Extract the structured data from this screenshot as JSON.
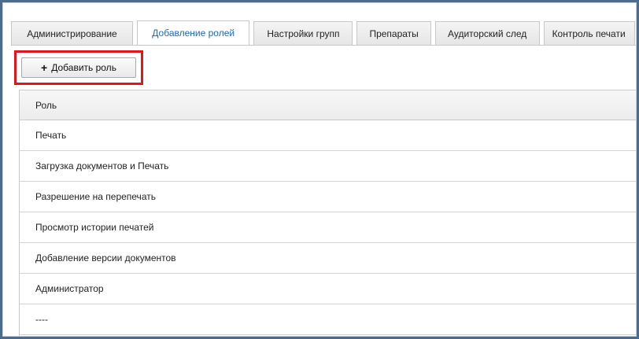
{
  "tabs": [
    {
      "label": "Администрирование",
      "active": false
    },
    {
      "label": "Добавление ролей",
      "active": true
    },
    {
      "label": "Настройки групп",
      "active": false
    },
    {
      "label": "Препараты",
      "active": false
    },
    {
      "label": "Аудиторский след",
      "active": false
    },
    {
      "label": "Контроль печати",
      "active": false
    }
  ],
  "toolbar": {
    "add_role_label": "Добавить роль",
    "add_role_icon": "plus-icon"
  },
  "grid": {
    "column_header": "Роль",
    "rows": [
      "Печать",
      "Загрузка документов и Печать",
      "Разрешение на перепечать",
      "Просмотр истории печатей",
      "Добавление версии документов",
      "Администратор",
      "----"
    ]
  },
  "colors": {
    "active_tab_text": "#1a67c6",
    "highlight_border": "#e3141a",
    "frame_border": "#4f6b8c"
  }
}
